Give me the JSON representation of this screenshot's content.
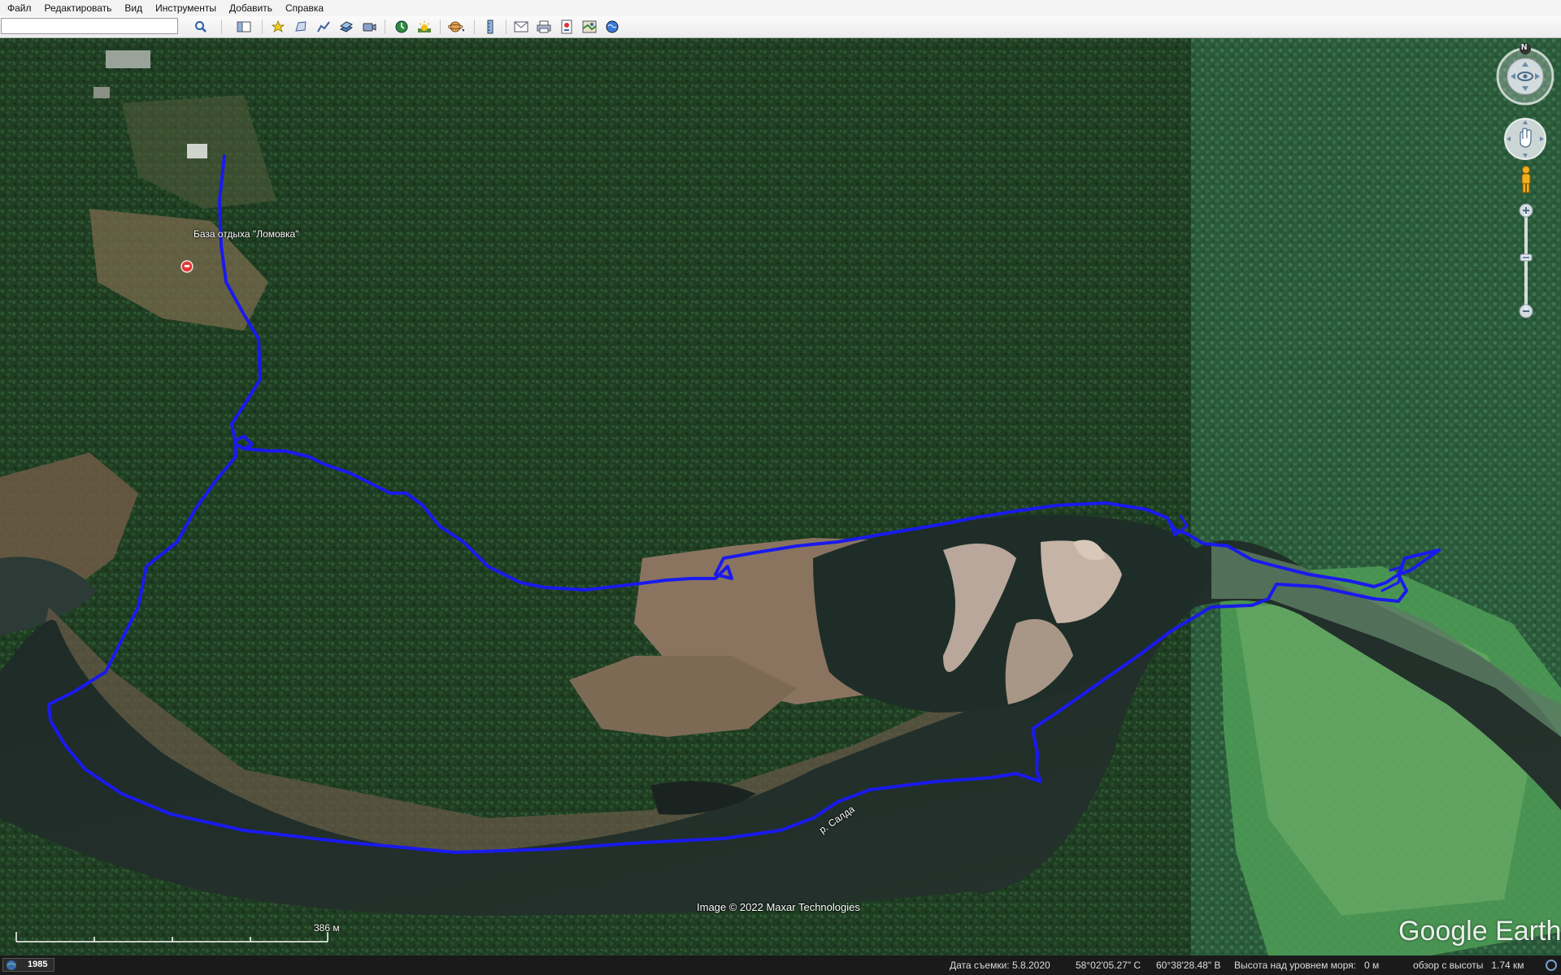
{
  "menu": [
    "Файл",
    "Редактировать",
    "Вид",
    "Инструменты",
    "Добавить",
    "Справка"
  ],
  "search": {
    "value": ""
  },
  "toolbar": {
    "buttons": [
      "search-icon",
      "sidebar-icon",
      "placemark-icon",
      "polygon-icon",
      "path-icon",
      "overlay-icon",
      "tour-icon",
      "historical-imagery-icon",
      "sunlight-icon",
      "planets-icon",
      "ruler-icon",
      "email-icon",
      "print-icon",
      "save-image-icon",
      "map-view-icon",
      "web-icon"
    ]
  },
  "map": {
    "place_label": "База отдыха \"Ломовка\"",
    "river_label": "р. Салда",
    "copyright": "Image © 2022 Maxar Technologies",
    "scale_label": "386 м",
    "brand": "Google Earth",
    "compass_north": "N",
    "track_color": "#1a1aee"
  },
  "status": {
    "year": "1985",
    "imagery_date": "Дата съемки: 5.8.2020",
    "lat": "58°02'05.27\" С",
    "lon": "60°38'28.48\" В",
    "elevation": "Высота над уровнем моря:   0 м",
    "eye_alt": "обзор с высоты   1.74 км"
  }
}
